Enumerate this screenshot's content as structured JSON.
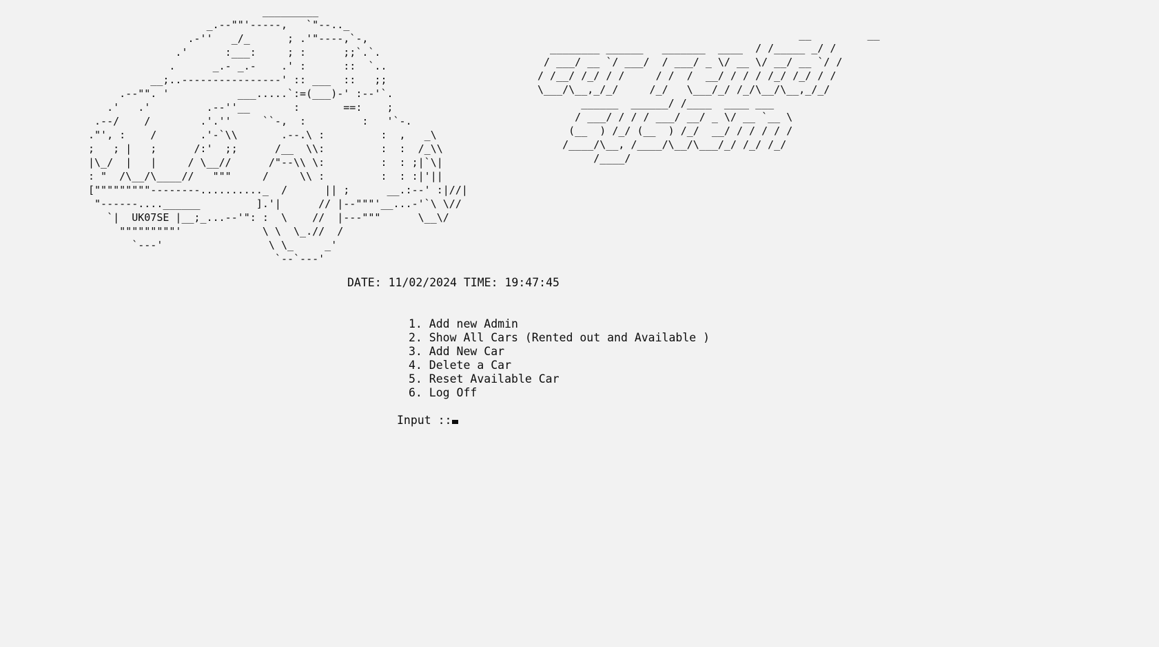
{
  "car_art": "                            _________\n                   _.--\"\"'-----,   `\"--.._\n                .-''   _/_      ; .'\"----,`-,\n              .'      :___:     ; :      ;;`.`.\n             .      _.- _.-    .' :      ::  `..\n          __;..----------------' :: ___  ::   ;;\n     .--\"\". '           ___.....`:=(___)-' :--'`.\n   .'   .'         .--''__       :       ==:    ;\n .--/    /        .'.''     ``-,  :         :   '`-.\n.\"', :    /       .'-`\\\\       .--.\\ :         :  ,   _\\\n;   ; |   ;      /:'  ;;      /__  \\\\:         :  :  /_\\\\\n|\\_/  |   |     / \\__//      /\"--\\\\ \\:         :  : ;|`\\|\n: \"  /\\__/\\____//   \"\"\"     /     \\\\ :         :  : :|'||\n[\"\"\"\"\"\"\"\"\"--------.........._  /      || ;      __.:--' :|//|\n \"------....______         ].'|      // |--\"\"\"'__...-'`\\ \\//\n   `|  UK07SE |__;_...--'\": :  \\    //  |---\"\"\"      \\__\\/\n     \"\"\"\"\"\"\"\"\"'             \\ \\  \\_.//  /\n       `---'                 \\ \\_     _'\n                              `--`---'",
  "title_art": "                                          __         __\n  ________ ______   _______  ____  / /_____ _/ /\n / ___/ __ `/ ___/  / ___/ _ \\/ __ \\/ __/ __ `/ /\n/ /__/ /_/ / /     / /  /  __/ / / / /_/ /_/ / /\n\\___/\\__,_/_/     /_/   \\___/_/ /_/\\__/\\__,_/_/\n       ______  ______/ /____  ____ ___\n      / ___/ / / / ___/ __/ _ \\/ __ `__ \\\n     (__  ) /_/ (__  ) /_/  __/ / / / / /\n    /____/\\__, /____/\\__/\\___/_/ /_/ /_/\n         /____/",
  "datetime": "DATE: 11/02/2024 TIME: 19:47:45",
  "menu": [
    "1. Add new Admin",
    "2. Show All Cars (Rented out and Available )",
    "3. Add New Car",
    "4. Delete a Car",
    "5. Reset Available Car",
    "6. Log Off"
  ],
  "prompt": "Input ::"
}
